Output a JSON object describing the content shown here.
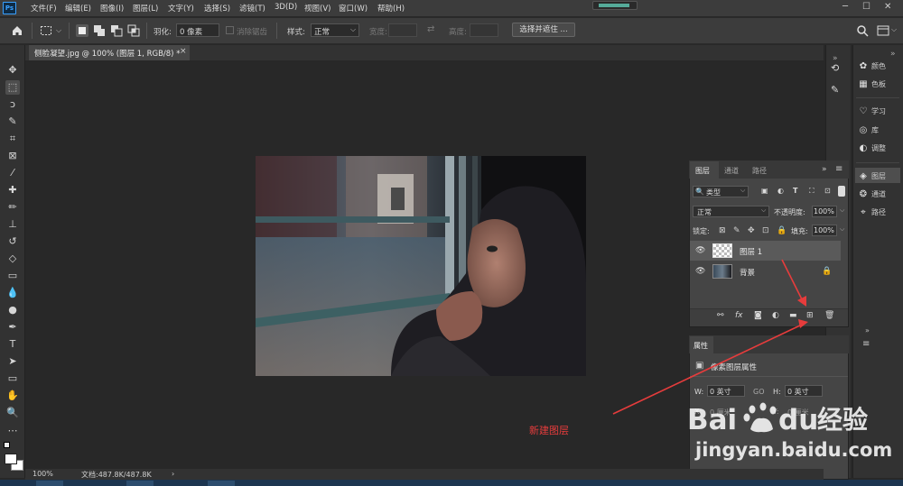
{
  "app": {
    "logo_text": "Ps"
  },
  "menu": [
    "文件(F)",
    "编辑(E)",
    "图像(I)",
    "图层(L)",
    "文字(Y)",
    "选择(S)",
    "滤镜(T)",
    "3D(D)",
    "视图(V)",
    "窗口(W)",
    "帮助(H)"
  ],
  "options_bar": {
    "feather_label": "羽化:",
    "feather_value": "0 像素",
    "antialias_label": "消除锯齿",
    "style_label": "样式:",
    "style_value": "正常",
    "width_label": "宽度:",
    "height_label": "高度:",
    "select_mask_button": "选择并遮住 ..."
  },
  "document": {
    "tab_label": "侧脸凝望.jpg @ 100% (图层 1, RGB/8) *",
    "close_glyph": "×"
  },
  "status": {
    "zoom": "100%",
    "doc_info": "文档:487.8K/487.8K",
    "arrow": "›"
  },
  "right_panels": {
    "strip2_items": [
      {
        "label": "颜色",
        "icon": "palette-icon"
      },
      {
        "label": "色板",
        "icon": "grid-icon"
      },
      {
        "label": "学习",
        "icon": "lightbulb-icon"
      },
      {
        "label": "库",
        "icon": "library-icon"
      },
      {
        "label": "调整",
        "icon": "adjust-icon"
      },
      {
        "label": "图层",
        "icon": "layers-icon"
      },
      {
        "label": "通道",
        "icon": "channels-icon"
      },
      {
        "label": "路径",
        "icon": "paths-icon"
      }
    ]
  },
  "layers_panel": {
    "tabs": [
      "图层",
      "通道",
      "路径"
    ],
    "filter_kind": "类型",
    "blend_mode": "正常",
    "opacity_label": "不透明度:",
    "opacity_value": "100%",
    "lock_label": "锁定:",
    "fill_label": "填充:",
    "fill_value": "100%",
    "layers": [
      {
        "name": "图层 1",
        "selected": true,
        "visible": true,
        "locked": false
      },
      {
        "name": "背景",
        "selected": false,
        "visible": true,
        "locked": true
      }
    ]
  },
  "properties_panel": {
    "title": "属性",
    "subtitle": "像素图层属性",
    "w_label": "W:",
    "w_value": "0 英寸",
    "h_label": "H:",
    "h_value": "0 英寸",
    "x_label": "X:",
    "x_value": "0 厘米",
    "y_label": "Y:",
    "y_value": "0 厘米",
    "go_label": "GO"
  },
  "annotation": {
    "label": "新建图层",
    "color": "#e63c3c"
  },
  "watermark": {
    "brand": "Bai du 经验",
    "url": "jingyan.baidu.com"
  },
  "colors": {
    "ui_dark": "#323232",
    "ui_panel": "#454545",
    "menubar": "#3c3c3c",
    "accent": "#3aa0ff"
  }
}
